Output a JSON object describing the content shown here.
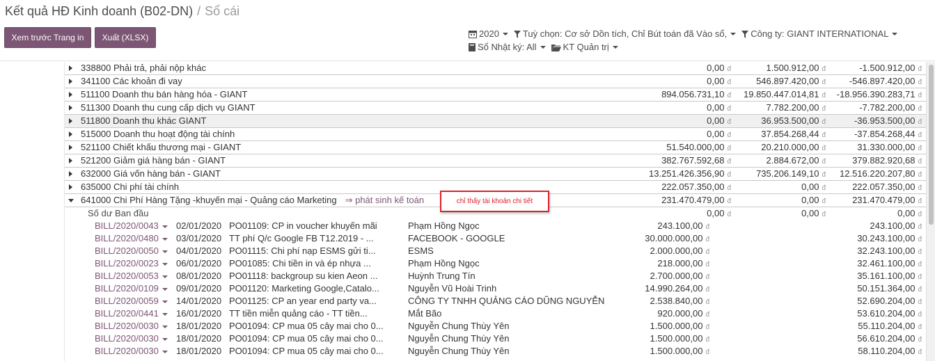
{
  "breadcrumb": {
    "parent": "Kết quả HĐ Kinh doanh (B02-DN)",
    "separator": "/",
    "current": "Sổ cái"
  },
  "buttons": {
    "print": "Xem trước Trang in",
    "export": "Xuất (XLSX)"
  },
  "filters": {
    "period": "2020",
    "options": "Tuỳ chọn: Cơ sở Dồn tích, Chỉ Bút toán đã Vào sổ,",
    "company": "Công ty: GIANT INTERNATIONAL",
    "journals": "Sổ Nhật ký: All",
    "analytic": "KT Quản trị"
  },
  "currency": "đ",
  "accounts": [
    {
      "name": "338800 Phải trả, phải nộp khác",
      "debit": "0,00",
      "credit": "1.500.912,00",
      "balance": "-1.500.912,00"
    },
    {
      "name": "341100 Các khoản đi vay",
      "debit": "0,00",
      "credit": "546.897.420,00",
      "balance": "-546.897.420,00"
    },
    {
      "name": "511100 Doanh thu bán hàng hóa - GIANT",
      "debit": "894.056.731,10",
      "credit": "19.850.447.014,81",
      "balance": "-18.956.390.283,71"
    },
    {
      "name": "511300 Doanh thu cung cấp dịch vụ GIANT",
      "debit": "0,00",
      "credit": "7.782.200,00",
      "balance": "-7.782.200,00"
    },
    {
      "name": "511800 Doanh thu khác GIANT",
      "debit": "0,00",
      "credit": "36.953.500,00",
      "balance": "-36.953.500,00"
    },
    {
      "name": "515000 Doanh thu hoạt động tài chính",
      "debit": "0,00",
      "credit": "37.854.268,44",
      "balance": "-37.854.268,44"
    },
    {
      "name": "521100 Chiết khấu thương mại - GIANT",
      "debit": "51.540.000,00",
      "credit": "20.210.000,00",
      "balance": "31.330.000,00"
    },
    {
      "name": "521200 Giảm giá hàng bán - GIANT",
      "debit": "382.767.592,68",
      "credit": "2.884.672,00",
      "balance": "379.882.920,68"
    },
    {
      "name": "632000 Giá vốn hàng bán - GIANT",
      "debit": "13.251.426.356,90",
      "credit": "735.206.149,10",
      "balance": "12.516.220.207,80"
    },
    {
      "name": "635000 Chi phí tài chính",
      "debit": "222.057.350,00",
      "credit": "0,00",
      "balance": "222.057.350,00"
    }
  ],
  "expanded_account": {
    "name": "641000 Chi Phí Hàng Tặng -khuyến mại - Quảng cáo Marketing",
    "drilldown": "⇒ phát sinh kế toán",
    "debit": "231.470.479,00",
    "credit": "0,00",
    "balance": "231.470.479,00"
  },
  "initial_balance": {
    "label": "Số dư Ban đầu",
    "debit": "0,00",
    "credit": "0,00",
    "balance": "0,00"
  },
  "lines": [
    {
      "ref": "BILL/2020/0043",
      "date": "02/01/2020",
      "desc": "PO01109: CP in voucher khuyến mãi",
      "partner": "Phạm Hồng Ngọc",
      "amount": "243.100,00",
      "balance": "243.100,00"
    },
    {
      "ref": "BILL/2020/0480",
      "date": "03/01/2020",
      "desc": "TT phí Q/c Google FB T12.2019 - ...",
      "partner": "FACEBOOK - GOOGLE",
      "amount": "30.000.000,00",
      "balance": "30.243.100,00"
    },
    {
      "ref": "BILL/2020/0050",
      "date": "04/01/2020",
      "desc": "PO01115: Chi phí nạp ESMS gửi ti...",
      "partner": "ESMS",
      "amount": "2.000.000,00",
      "balance": "32.243.100,00"
    },
    {
      "ref": "BILL/2020/0023",
      "date": "06/01/2020",
      "desc": "PO01085: Chi tiền in và ép nhựa ...",
      "partner": "Phạm Hồng Ngọc",
      "amount": "218.000,00",
      "balance": "32.461.100,00"
    },
    {
      "ref": "BILL/2020/0053",
      "date": "08/01/2020",
      "desc": "PO01118: backgroup su kien Aeon ...",
      "partner": "Huỳnh Trung Tín",
      "amount": "2.700.000,00",
      "balance": "35.161.100,00"
    },
    {
      "ref": "BILL/2020/0109",
      "date": "09/01/2020",
      "desc": "PO01120: Marketing Google,Catalo...",
      "partner": "Nguyễn Vũ Hoài Trinh",
      "amount": "14.990.264,00",
      "balance": "50.151.364,00"
    },
    {
      "ref": "BILL/2020/0059",
      "date": "14/01/2020",
      "desc": "PO01125: CP an year end party va...",
      "partner": "CÔNG TY TNHH QUẢNG CÁO DŨNG NGUYỄN",
      "amount": "2.538.840,00",
      "balance": "52.690.204,00"
    },
    {
      "ref": "BILL/2020/0441",
      "date": "16/01/2020",
      "desc": "TT tiền miễn quảng cáo - TT tiền...",
      "partner": "Mắt Bão",
      "amount": "920.000,00",
      "balance": "53.610.204,00"
    },
    {
      "ref": "BILL/2020/0030",
      "date": "18/01/2020",
      "desc": "PO01094: CP mua 05 cây mai cho 0...",
      "partner": "Nguyễn Chung Thùy Yên",
      "amount": "1.500.000,00",
      "balance": "55.110.204,00"
    },
    {
      "ref": "BILL/2020/0030",
      "date": "18/01/2020",
      "desc": "PO01094: CP mua 05 cây mai cho 0...",
      "partner": "Nguyễn Chung Thùy Yên",
      "amount": "1.500.000,00",
      "balance": "56.610.204,00"
    },
    {
      "ref": "BILL/2020/0030",
      "date": "18/01/2020",
      "desc": "PO01094: CP mua 05 cây mai cho 0...",
      "partner": "Nguyễn Chung Thùy Yên",
      "amount": "1.500.000,00",
      "balance": "58.110.204,00"
    }
  ],
  "annotation": "chỉ thấy tài khoản chi tiết"
}
